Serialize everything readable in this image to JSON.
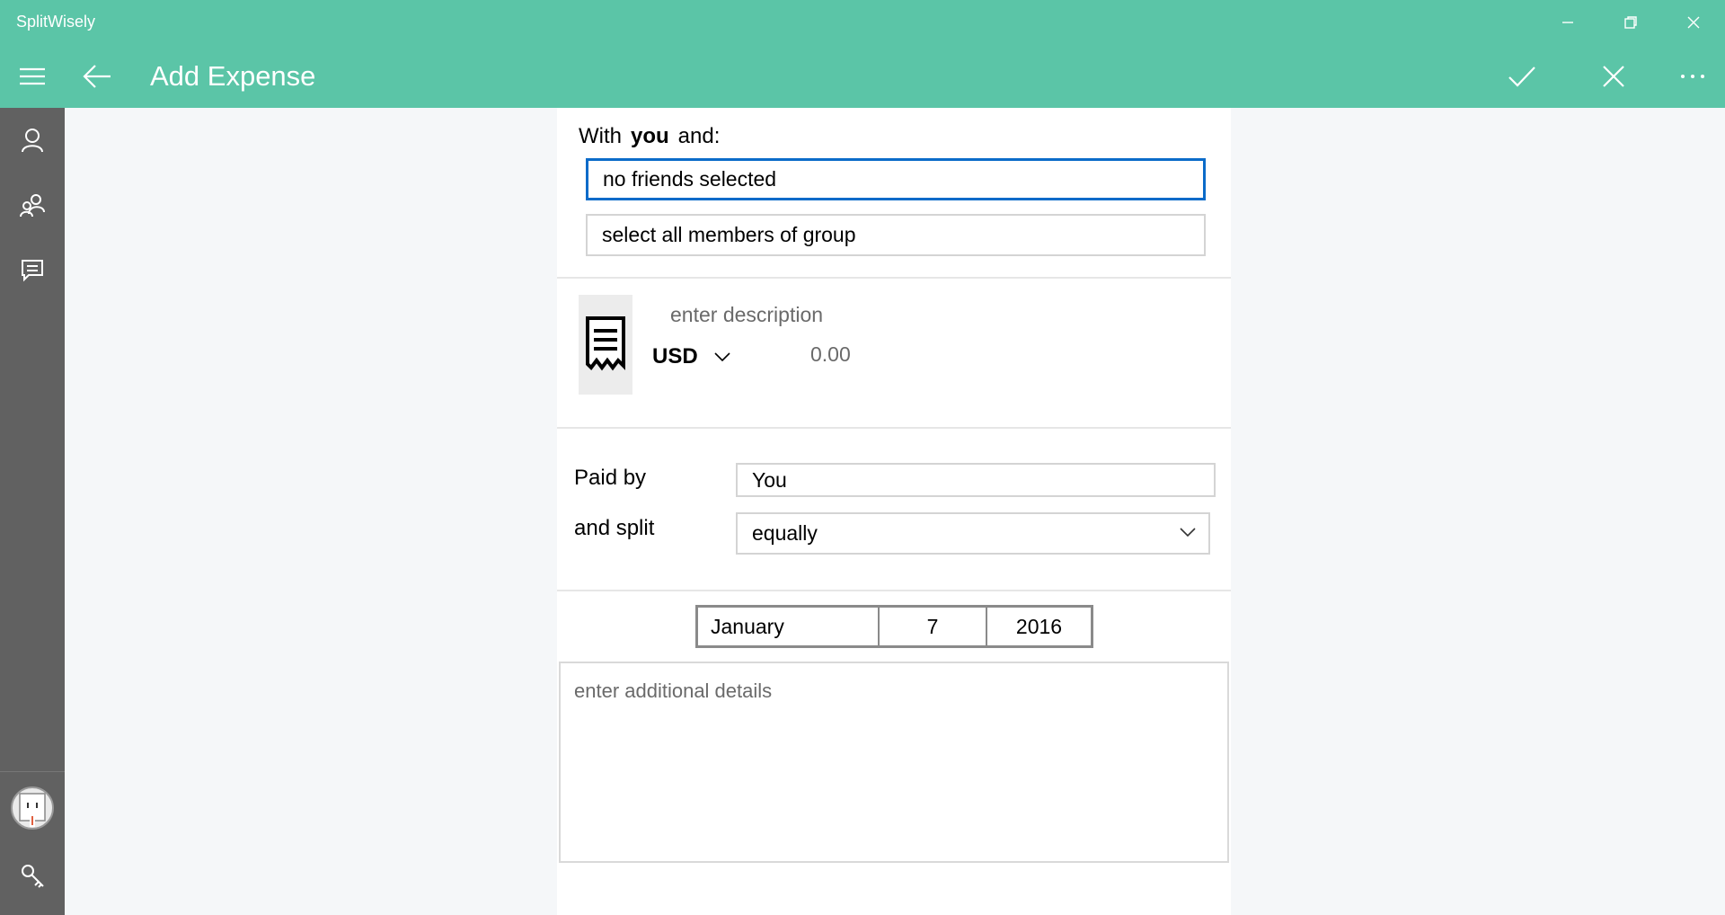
{
  "window": {
    "app_title": "SplitWisely",
    "minimize_icon": "minimize-icon",
    "restore_icon": "restore-icon",
    "close_icon": "close-icon"
  },
  "command_bar": {
    "page_title": "Add Expense",
    "icons": [
      "hamburger-menu-icon",
      "back-arrow-icon",
      "checkmark-icon",
      "cancel-icon",
      "more-ellipsis-icon"
    ]
  },
  "sidebar": {
    "items": [
      {
        "icon": "person-icon"
      },
      {
        "icon": "group-icon"
      },
      {
        "icon": "comment-icon"
      },
      {
        "icon": "avatar"
      },
      {
        "icon": "key-icon"
      }
    ]
  },
  "form": {
    "with_prefix": "With",
    "with_you": "you",
    "with_suffix": "and:",
    "friends_input_value": "no friends selected",
    "select_all_label": "select all members of group",
    "description_placeholder": "enter description",
    "currency": "USD",
    "amount_placeholder": "0.00",
    "paid_by_label": "Paid by",
    "paid_by_value": "You",
    "split_label": "and split",
    "split_value": "equally",
    "date": {
      "month": "January",
      "day": "7",
      "year": "2016"
    },
    "details_placeholder": "enter additional details"
  },
  "colors": {
    "accent": "#5bc5a7",
    "sidebar": "#616161",
    "focus_border": "#0b6bc9"
  }
}
